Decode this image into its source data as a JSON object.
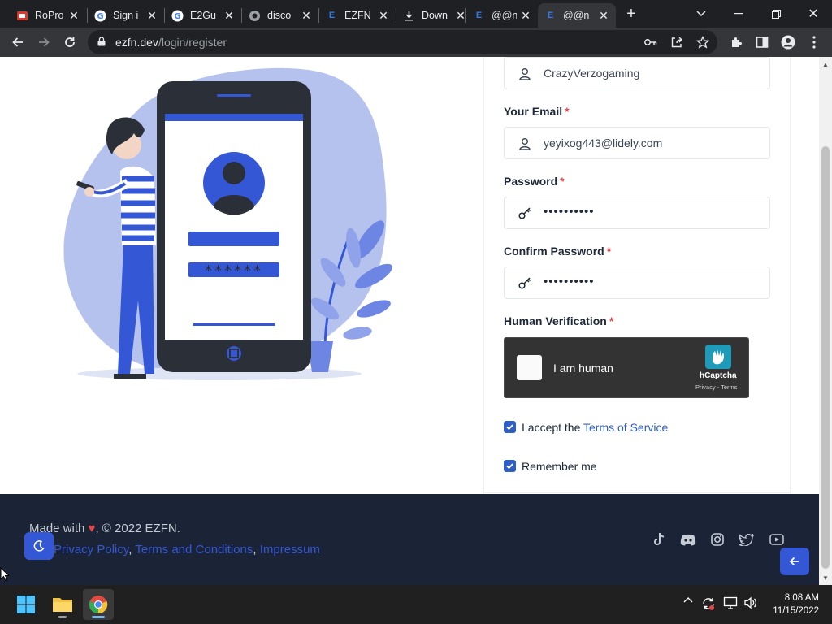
{
  "browser": {
    "tabs": [
      {
        "title": "RoPro",
        "icon": "ropro-icon"
      },
      {
        "title": "Sign i",
        "icon": "google-icon"
      },
      {
        "title": "E2Gu",
        "icon": "google-icon"
      },
      {
        "title": "disco",
        "icon": "globe-icon"
      },
      {
        "title": "EZFN",
        "icon": "ezfn-icon"
      },
      {
        "title": "Down",
        "icon": "download-icon"
      },
      {
        "title": "@@n",
        "icon": "ezfn-icon"
      },
      {
        "title": "@@n",
        "icon": "ezfn-icon",
        "active": true
      }
    ],
    "url_domain": "ezfn.dev",
    "url_path": "/login/register"
  },
  "form": {
    "username_value": "CrazyVerzogaming",
    "email_label": "Your Email",
    "email_value": "yeyixog443@lidely.com",
    "password_label": "Password",
    "password_value": "••••••••••",
    "confirm_label": "Confirm Password",
    "confirm_value": "••••••••••",
    "verification_label": "Human Verification",
    "required_mark": "*",
    "captcha_text": "I am human",
    "captcha_brand": "hCaptcha",
    "captcha_links": "Privacy - Terms",
    "terms_prefix": "I accept the ",
    "terms_link": "Terms of Service",
    "remember_label": "Remember me"
  },
  "illustration": {
    "password_mask": "******"
  },
  "footer": {
    "made_prefix": "Made with ",
    "heart": "♥",
    "made_suffix": ", © 2022 EZFN.",
    "privacy": "Privacy Policy",
    "terms": "Terms and Conditions",
    "impressum": "Impressum",
    "separator": ", "
  },
  "taskbar": {
    "time": "8:08 AM",
    "date": "11/15/2022"
  },
  "colors": {
    "accent": "#2f5ec7",
    "footer_bg": "#1b2436",
    "required": "#e0464c"
  }
}
